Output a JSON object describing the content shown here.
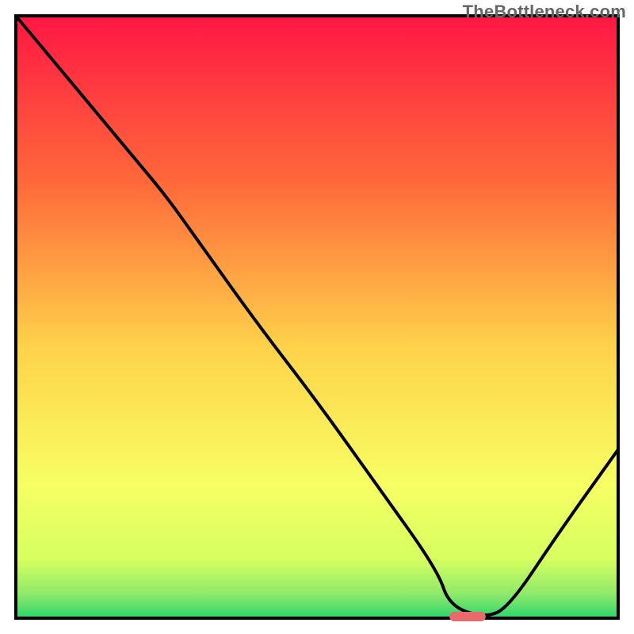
{
  "watermark": "TheBottleneck.com",
  "colors": {
    "gradient_top": "#ff1744",
    "gradient_upper_mid": "#ff7a3a",
    "gradient_mid": "#ffd24a",
    "gradient_lower_mid": "#f6ff64",
    "gradient_low": "#d7ff5f",
    "gradient_bottom": "#2bd66b",
    "curve": "#000000",
    "marker": "#e86a6a",
    "axis": "#000000"
  },
  "chart_data": {
    "type": "line",
    "title": "",
    "xlabel": "",
    "ylabel": "",
    "xlim": [
      0,
      100
    ],
    "ylim": [
      0,
      100
    ],
    "series": [
      {
        "name": "bottleneck-curve",
        "x": [
          0,
          10,
          20,
          25,
          30,
          40,
          50,
          60,
          70,
          72,
          78,
          82,
          90,
          100
        ],
        "values": [
          100,
          88,
          76,
          70,
          63,
          49,
          36,
          22,
          8,
          2,
          0,
          2,
          14,
          28
        ]
      }
    ],
    "marker": {
      "x_start": 72,
      "x_end": 78,
      "y": 0
    },
    "axes_visible": false,
    "legend": false
  }
}
